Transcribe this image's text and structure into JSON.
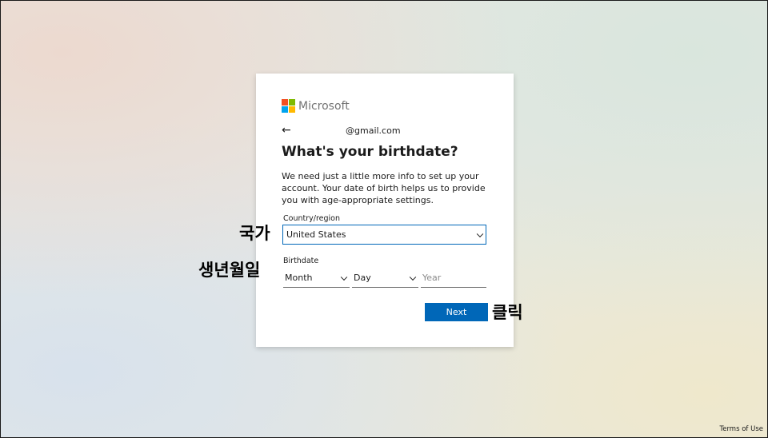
{
  "brand": {
    "name": "Microsoft",
    "logo_colors": [
      "#f25022",
      "#7fba00",
      "#00a4ef",
      "#ffb900"
    ]
  },
  "identity": {
    "email": "@gmail.com",
    "back_icon": "arrow-left-icon"
  },
  "form": {
    "title": "What's your birthdate?",
    "description": "We need just a little more info to set up your account. Your date of birth helps us to provide you with age-appropriate settings.",
    "country_label": "Country/region",
    "country_value": "United States",
    "birthdate_label": "Birthdate",
    "month_value": "Month",
    "day_value": "Day",
    "year_placeholder": "Year",
    "next_label": "Next"
  },
  "annotations": {
    "country": "국가",
    "birthdate": "생년월일",
    "click": "클릭"
  },
  "footer": {
    "terms": "Terms of Use"
  },
  "colors": {
    "accent": "#0067b8"
  }
}
